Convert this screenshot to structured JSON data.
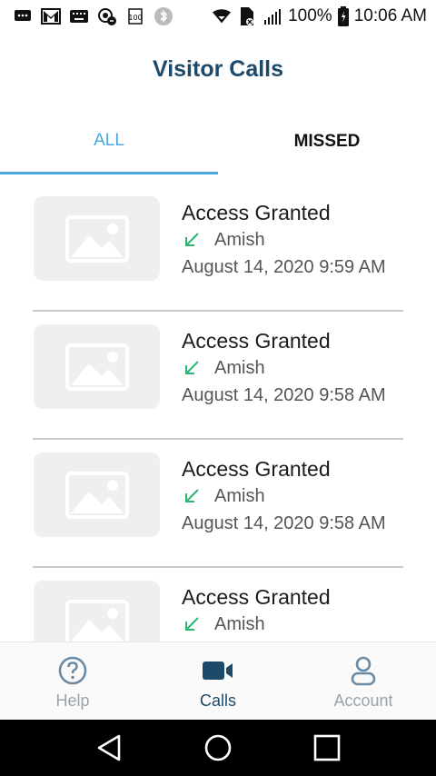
{
  "status": {
    "battery": "100%",
    "time": "10:06 AM",
    "icons": [
      "message-icon",
      "gmail-icon",
      "keyboard-icon",
      "vpn-icon",
      "counter-icon",
      "bluetooth-icon",
      "wifi-icon",
      "sim-icon",
      "signal-icon",
      "battery-icon"
    ]
  },
  "header": {
    "title": "Visitor Calls"
  },
  "tabs": [
    {
      "label": "ALL",
      "active": true
    },
    {
      "label": "MISSED",
      "active": false
    }
  ],
  "calls": [
    {
      "title": "Access Granted",
      "user": "Amish",
      "date": "August 14, 2020 9:59 AM"
    },
    {
      "title": "Access Granted",
      "user": "Amish",
      "date": "August 14, 2020 9:58 AM"
    },
    {
      "title": "Access Granted",
      "user": "Amish",
      "date": "August 14, 2020 9:58 AM"
    },
    {
      "title": "Access Granted",
      "user": "Amish",
      "date": ""
    }
  ],
  "bottom_nav": [
    {
      "label": "Help",
      "icon": "help-icon",
      "active": false
    },
    {
      "label": "Calls",
      "icon": "video-camera-icon",
      "active": true
    },
    {
      "label": "Account",
      "icon": "user-icon",
      "active": false
    }
  ],
  "colors": {
    "accent": "#4aa8e0",
    "title": "#1d4a6b",
    "arrow": "#2bb673"
  }
}
